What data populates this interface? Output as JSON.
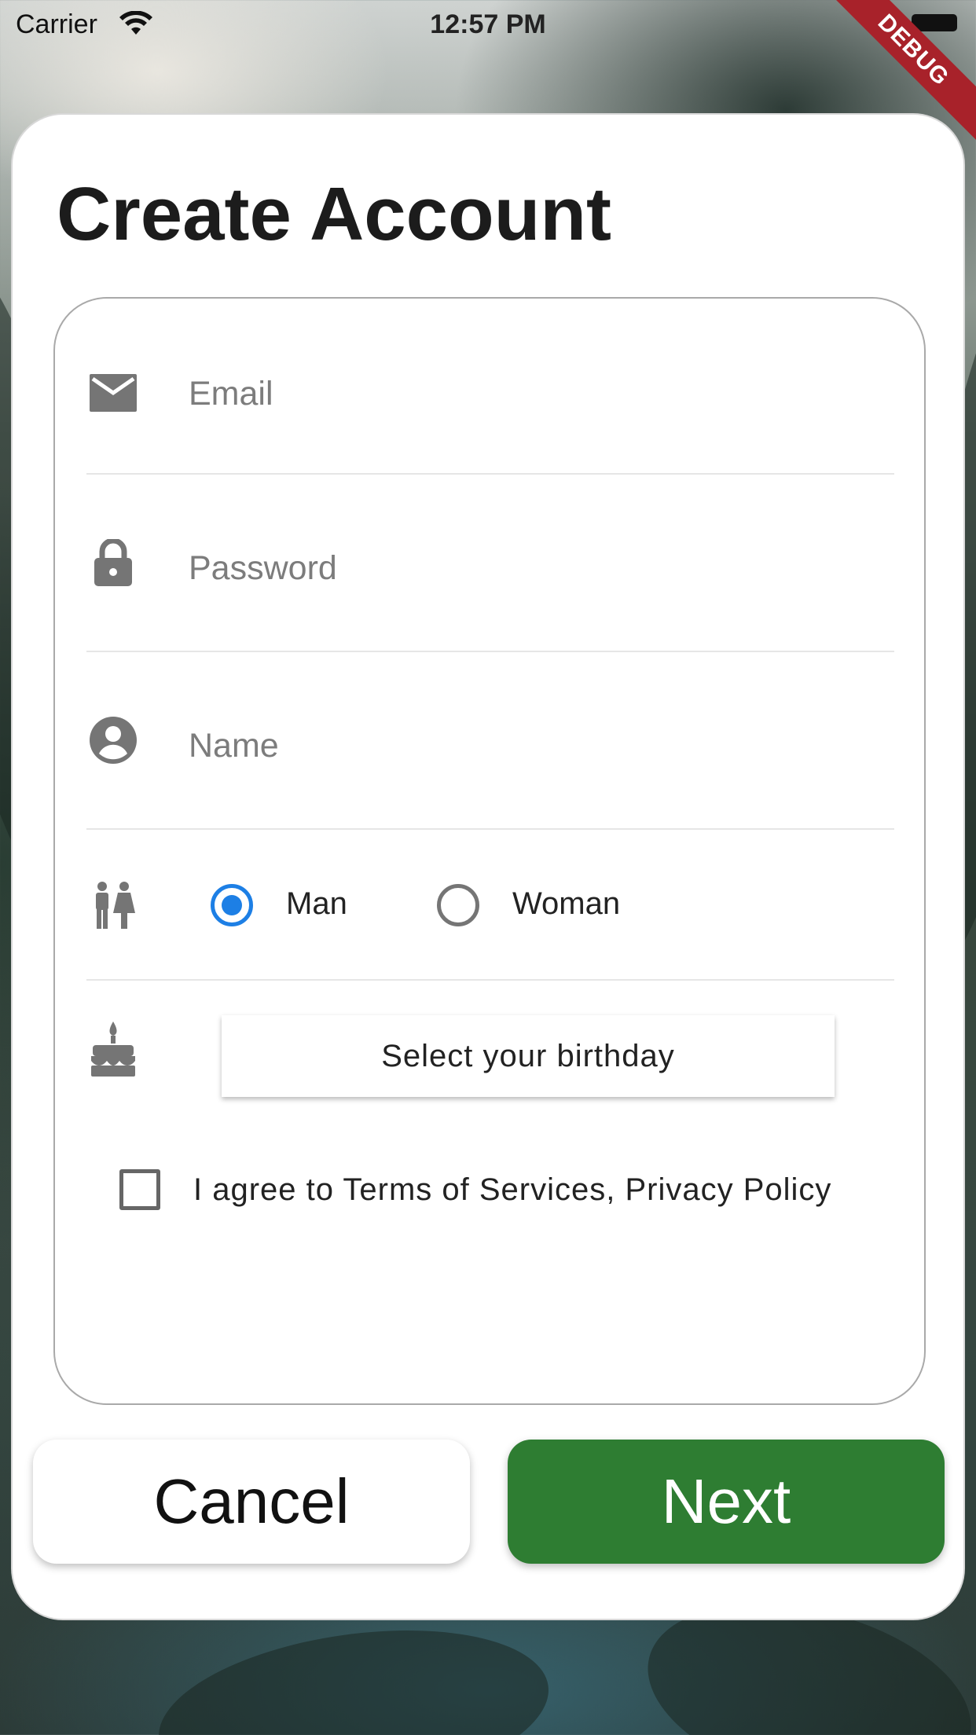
{
  "status_bar": {
    "carrier": "Carrier",
    "time": "12:57 PM",
    "debug_label": "DEBUG"
  },
  "page": {
    "title": "Create Account"
  },
  "form": {
    "email": {
      "placeholder": "Email",
      "value": "",
      "icon": "mail-icon"
    },
    "password": {
      "placeholder": "Password",
      "value": "",
      "icon": "lock-icon"
    },
    "name": {
      "placeholder": "Name",
      "value": "",
      "icon": "account-circle-icon"
    },
    "gender": {
      "icon": "wc-icon",
      "options": [
        {
          "label": "Man",
          "selected": true
        },
        {
          "label": "Woman",
          "selected": false
        }
      ]
    },
    "birthday": {
      "icon": "cake-icon",
      "button_label": "Select your birthday"
    },
    "agree": {
      "label": "I agree to Terms of Services, Privacy Policy",
      "checked": false
    }
  },
  "actions": {
    "cancel_label": "Cancel",
    "next_label": "Next"
  },
  "colors": {
    "accent": "#1d7fe5",
    "primary_button": "#2e7d32",
    "icon_gray": "#757575"
  }
}
